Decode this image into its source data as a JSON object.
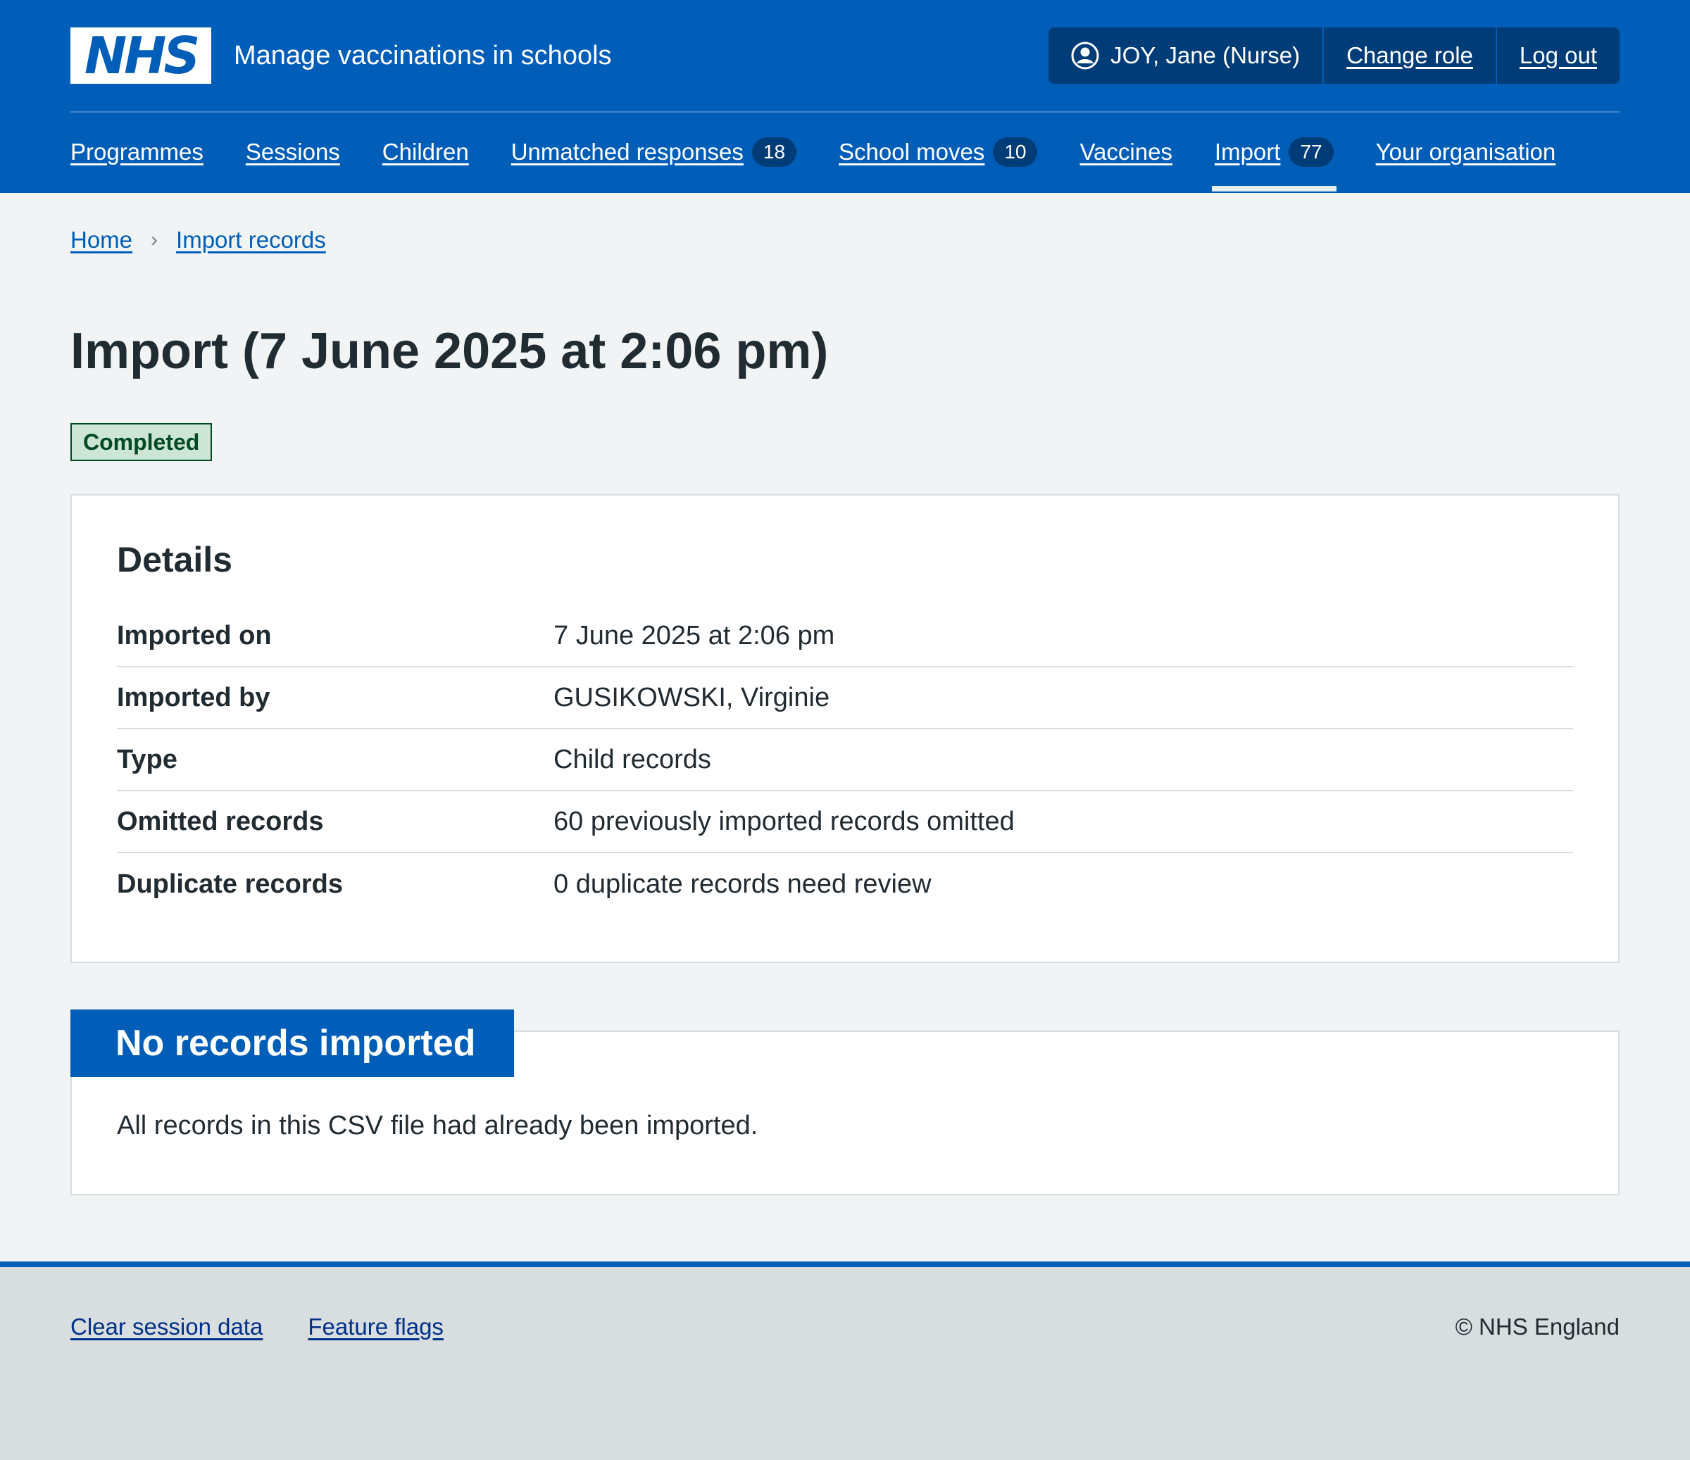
{
  "header": {
    "logo_text": "NHS",
    "service_name": "Manage vaccinations in schools",
    "account": {
      "user": "JOY, Jane (Nurse)",
      "change_role": "Change role",
      "log_out": "Log out"
    },
    "nav": [
      {
        "label": "Programmes"
      },
      {
        "label": "Sessions"
      },
      {
        "label": "Children"
      },
      {
        "label": "Unmatched responses",
        "count": "18"
      },
      {
        "label": "School moves",
        "count": "10"
      },
      {
        "label": "Vaccines"
      },
      {
        "label": "Import",
        "count": "77",
        "active": true
      },
      {
        "label": "Your organisation"
      }
    ]
  },
  "breadcrumb": {
    "home": "Home",
    "separator": "›",
    "import_records": "Import records"
  },
  "page": {
    "title": "Import (7 June 2025 at 2:06 pm)",
    "status": "Completed"
  },
  "details": {
    "heading": "Details",
    "rows": [
      {
        "key": "Imported on",
        "value": "7 June 2025 at 2:06 pm"
      },
      {
        "key": "Imported by",
        "value": "GUSIKOWSKI, Virginie"
      },
      {
        "key": "Type",
        "value": "Child records"
      },
      {
        "key": "Omitted records",
        "value": "60 previously imported records omitted"
      },
      {
        "key": "Duplicate records",
        "value": "0 duplicate records need review"
      }
    ]
  },
  "result": {
    "heading": "No records imported",
    "text": "All records in this CSV file had already been imported."
  },
  "footer": {
    "clear_session": "Clear session data",
    "feature_flags": "Feature flags",
    "copyright": "© NHS England"
  },
  "colors": {
    "brand_blue": "#005eb8",
    "dark_blue": "#003d78",
    "status_green_bg": "#cce5d5",
    "status_green_text": "#004b23"
  }
}
